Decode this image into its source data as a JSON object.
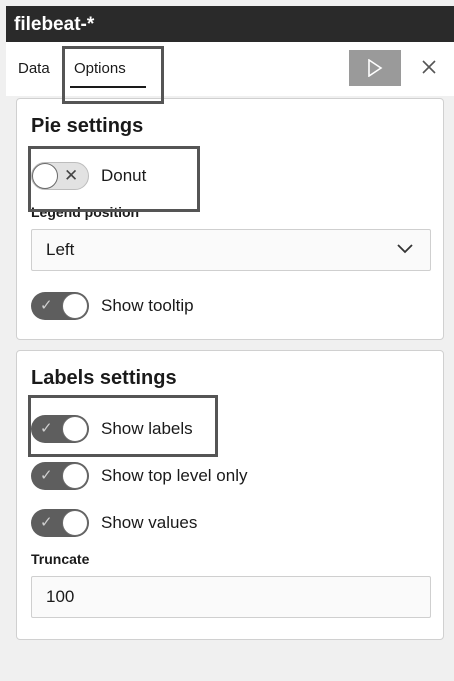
{
  "header": {
    "title": "filebeat-*"
  },
  "tabs": [
    {
      "label": "Data",
      "active": false
    },
    {
      "label": "Options",
      "active": true
    }
  ],
  "toolbar": {
    "run_icon": "play-icon",
    "close_icon": "close-icon"
  },
  "pie_settings": {
    "title": "Pie settings",
    "donut": {
      "label": "Donut",
      "state": "off"
    },
    "legend_position": {
      "label": "Legend position",
      "value": "Left"
    },
    "show_tooltip": {
      "label": "Show tooltip",
      "state": "on"
    }
  },
  "labels_settings": {
    "title": "Labels settings",
    "show_labels": {
      "label": "Show labels",
      "state": "on"
    },
    "show_top_level_only": {
      "label": "Show top level only",
      "state": "on"
    },
    "show_values": {
      "label": "Show values",
      "state": "on"
    },
    "truncate": {
      "label": "Truncate",
      "value": "100"
    }
  },
  "colors": {
    "header_bg": "#2a2a2a",
    "switch_on": "#5e5e5e",
    "run_button": "#9a9a9a"
  }
}
